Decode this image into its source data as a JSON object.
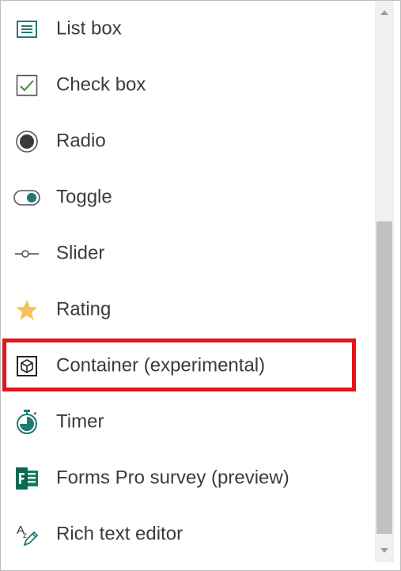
{
  "menu": {
    "items": [
      {
        "label": "List box",
        "icon": "list-box-icon"
      },
      {
        "label": "Check box",
        "icon": "check-box-icon"
      },
      {
        "label": "Radio",
        "icon": "radio-icon"
      },
      {
        "label": "Toggle",
        "icon": "toggle-icon"
      },
      {
        "label": "Slider",
        "icon": "slider-icon"
      },
      {
        "label": "Rating",
        "icon": "star-icon"
      },
      {
        "label": "Container (experimental)",
        "icon": "container-icon"
      },
      {
        "label": "Timer",
        "icon": "timer-icon"
      },
      {
        "label": "Forms Pro survey (preview)",
        "icon": "forms-pro-icon"
      },
      {
        "label": "Rich text editor",
        "icon": "rich-text-editor-icon"
      }
    ]
  },
  "colors": {
    "highlight": "#e3151a",
    "teal_icon": "#1f7a73",
    "checkbox_green": "#3c8d3c",
    "star": "#f6c15a",
    "forms_pro": "#0f7b5f"
  }
}
